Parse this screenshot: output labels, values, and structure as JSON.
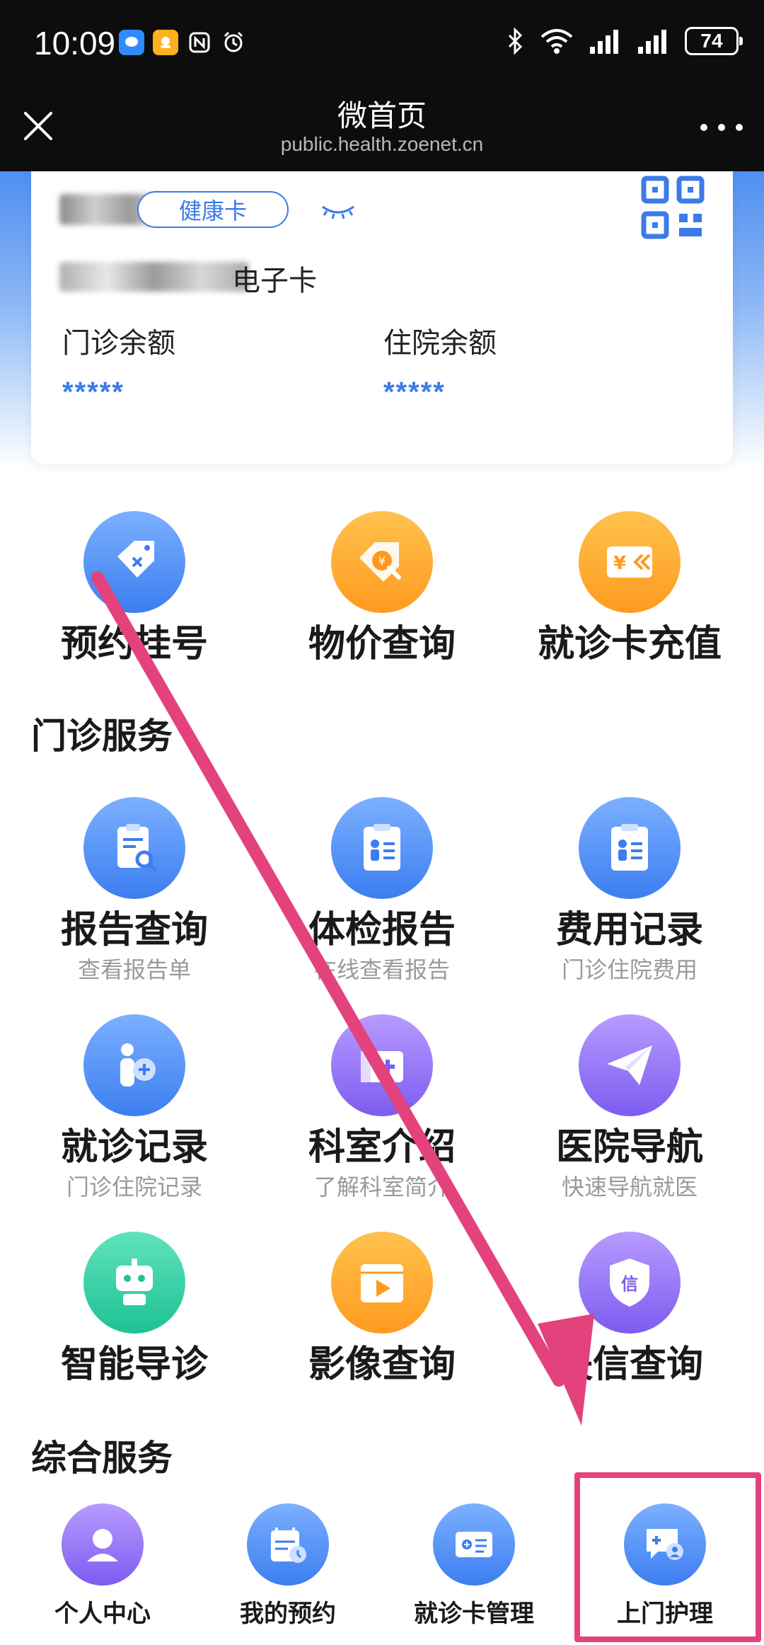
{
  "status_bar": {
    "time": "10:09",
    "battery": "74"
  },
  "title_bar": {
    "title": "微首页",
    "url": "public.health.zoenet.cn"
  },
  "card": {
    "badge": "健康卡",
    "card_suffix": "电子卡",
    "outpatient_label": "门诊余额",
    "outpatient_value": "*****",
    "inpatient_label": "住院余额",
    "inpatient_value": "*****"
  },
  "top_actions": [
    {
      "label": "预约挂号",
      "icon": "ticket-icon"
    },
    {
      "label": "物价查询",
      "icon": "price-search-icon"
    },
    {
      "label": "就诊卡充值",
      "icon": "card-recharge-icon"
    }
  ],
  "outpatient_section": {
    "title": "门诊服务",
    "items": [
      {
        "label": "报告查询",
        "sub": "查看报告单",
        "icon": "report-search-icon"
      },
      {
        "label": "体检报告",
        "sub": "在线查看报告",
        "icon": "clipboard-person-icon"
      },
      {
        "label": "费用记录",
        "sub": "门诊住院费用",
        "icon": "clipboard-list-icon"
      },
      {
        "label": "就诊记录",
        "sub": "门诊住院记录",
        "icon": "patient-add-icon"
      },
      {
        "label": "科室介绍",
        "sub": "了解科室简介",
        "icon": "department-icon"
      },
      {
        "label": "医院导航",
        "sub": "快速导航就医",
        "icon": "paper-plane-icon"
      },
      {
        "label": "智能导诊",
        "sub": "",
        "icon": "robot-icon"
      },
      {
        "label": "影像查询",
        "sub": "",
        "icon": "video-play-icon"
      },
      {
        "label": "失信查询",
        "sub": "",
        "icon": "shield-credit-icon"
      }
    ]
  },
  "general_section": {
    "title": "综合服务",
    "items": [
      {
        "label": "个人中心",
        "icon": "user-icon"
      },
      {
        "label": "我的预约",
        "icon": "calendar-clock-icon"
      },
      {
        "label": "就诊卡管理",
        "icon": "card-manage-icon"
      },
      {
        "label": "上门护理",
        "icon": "home-nursing-icon"
      }
    ]
  },
  "colors": {
    "accent_blue": "#3b7be8",
    "annotation_pink": "#e3427d"
  }
}
